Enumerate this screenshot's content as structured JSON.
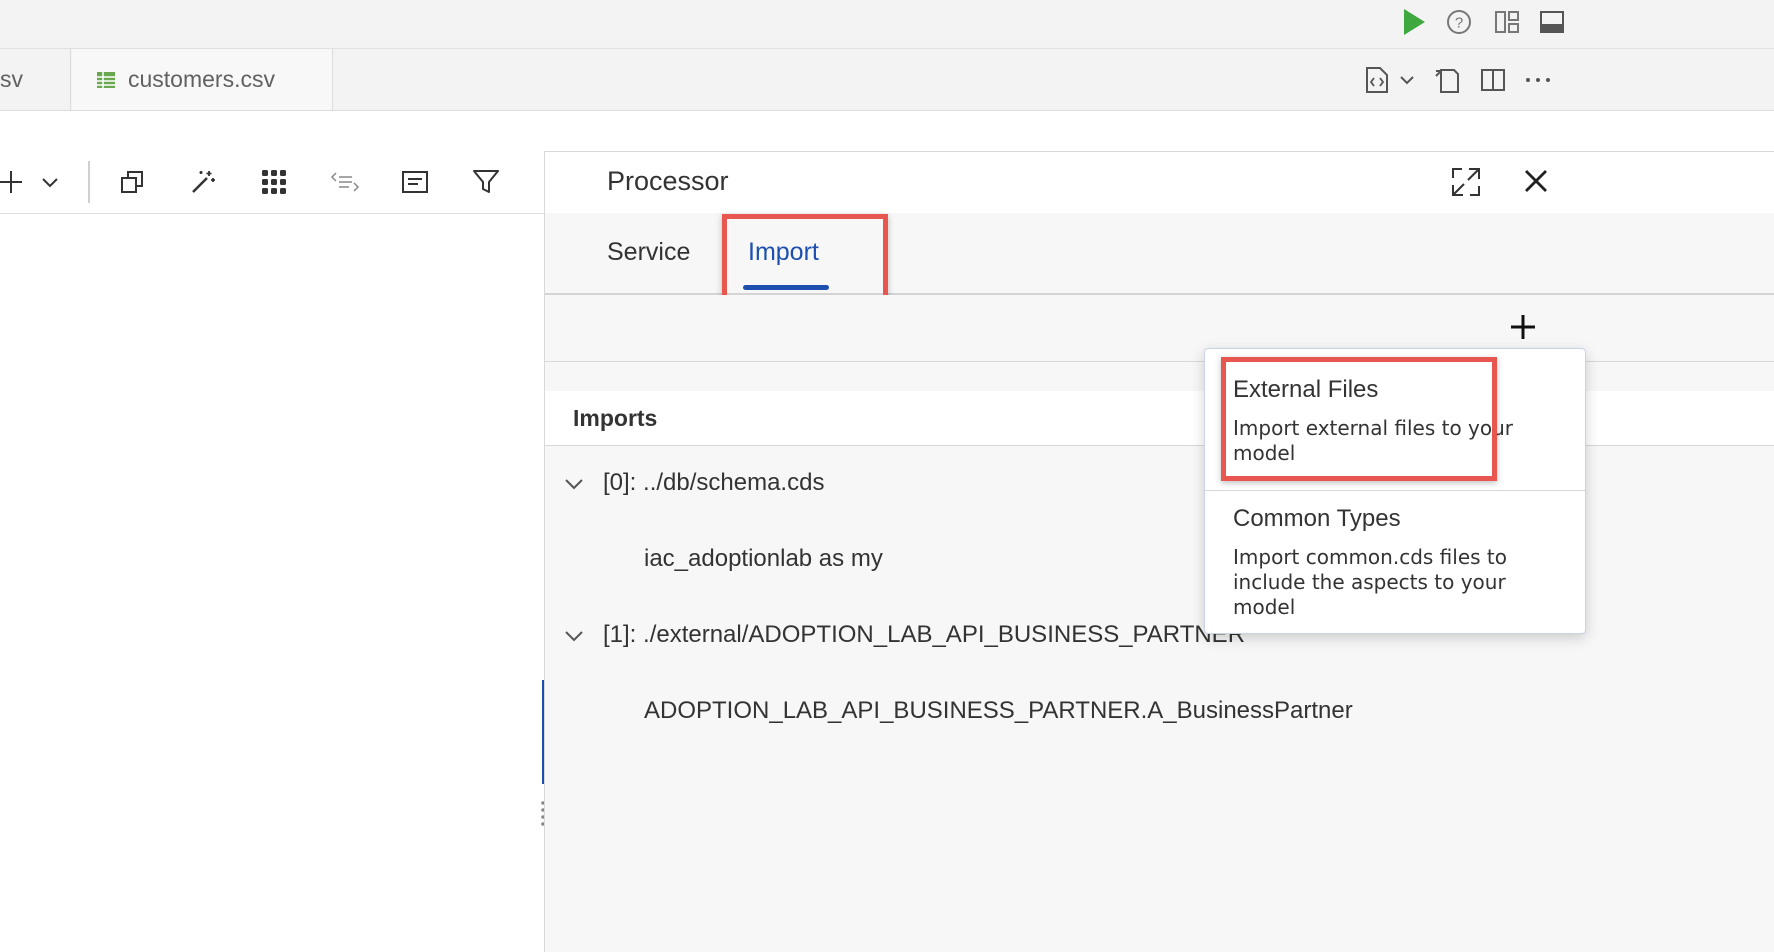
{
  "tabs": {
    "previous_label": "sv",
    "customers_label": "customers.csv"
  },
  "processor": {
    "title": "Processor",
    "tabs": [
      {
        "label": "Service",
        "active": false
      },
      {
        "label": "Import",
        "active": true
      }
    ],
    "imports_heading": "Imports",
    "imports": [
      {
        "label": "[0]: ../db/schema.cds",
        "child": "iac_adoptionlab as my"
      },
      {
        "label": "[1]: ./external/ADOPTION_LAB_API_BUSINESS_PARTNER",
        "child": "ADOPTION_LAB_API_BUSINESS_PARTNER.A_BusinessPartner"
      }
    ]
  },
  "dropdown": {
    "items": [
      {
        "title": "External Files",
        "description": "Import external files to your model"
      },
      {
        "title": "Common Types",
        "description": "Import common.cds files to include the aspects to your model"
      }
    ]
  },
  "icons": {
    "run": "play-icon",
    "help": "help-icon",
    "layout": "layout-icon",
    "panel": "panel-icon",
    "accent_green": "#3fa83f",
    "accent_blue": "#1d4fb0",
    "highlight_red": "#e8574f"
  }
}
